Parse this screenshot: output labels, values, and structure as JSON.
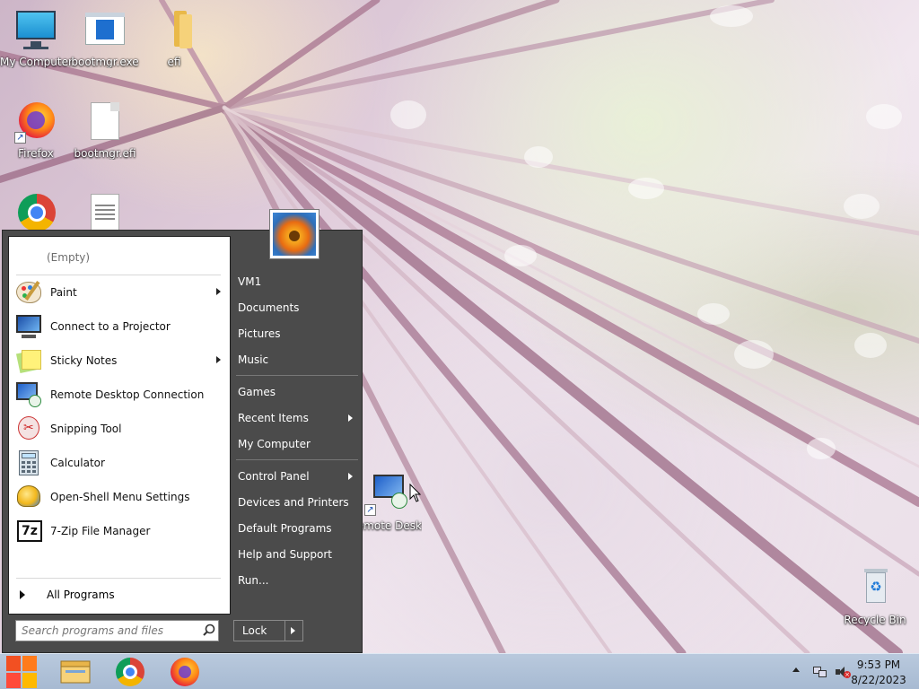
{
  "desktop": {
    "icons": [
      {
        "label": "My Computer"
      },
      {
        "label": "bootmgr.exe"
      },
      {
        "label": "efi"
      },
      {
        "label": "Firefox"
      },
      {
        "label": "bootmgr.efi"
      },
      {
        "label": "Remote Desktop ..."
      },
      {
        "label": "Recycle Bin"
      }
    ]
  },
  "start_menu": {
    "recent_empty": "(Empty)",
    "programs": [
      {
        "label": "Paint",
        "icon": "paint-icon",
        "has_submenu": true
      },
      {
        "label": "Connect to a Projector",
        "icon": "projector-icon",
        "has_submenu": false
      },
      {
        "label": "Sticky Notes",
        "icon": "sticky-notes-icon",
        "has_submenu": true
      },
      {
        "label": "Remote Desktop Connection",
        "icon": "remote-desktop-icon",
        "has_submenu": false
      },
      {
        "label": "Snipping Tool",
        "icon": "snipping-tool-icon",
        "has_submenu": false
      },
      {
        "label": "Calculator",
        "icon": "calculator-icon",
        "has_submenu": false
      },
      {
        "label": "Open-Shell Menu Settings",
        "icon": "open-shell-icon",
        "has_submenu": false
      },
      {
        "label": "7-Zip File Manager",
        "icon": "seven-zip-icon",
        "has_submenu": false
      }
    ],
    "all_programs": "All Programs",
    "search_placeholder": "Search programs and files",
    "right": {
      "group1": [
        "VM1",
        "Documents",
        "Pictures",
        "Music"
      ],
      "group2": [
        "Games",
        "Recent Items",
        "My Computer"
      ],
      "group3": [
        "Control Panel",
        "Devices and Printers",
        "Default Programs",
        "Help and Support",
        "Run..."
      ]
    },
    "lock_label": "Lock"
  },
  "taskbar": {
    "time": "9:53 PM",
    "date": "8/22/2023"
  },
  "colors": {
    "menu_dark": "#4b4b4b",
    "taskbar": "#b0c2d8",
    "accent_orange": "#f39a1b"
  }
}
